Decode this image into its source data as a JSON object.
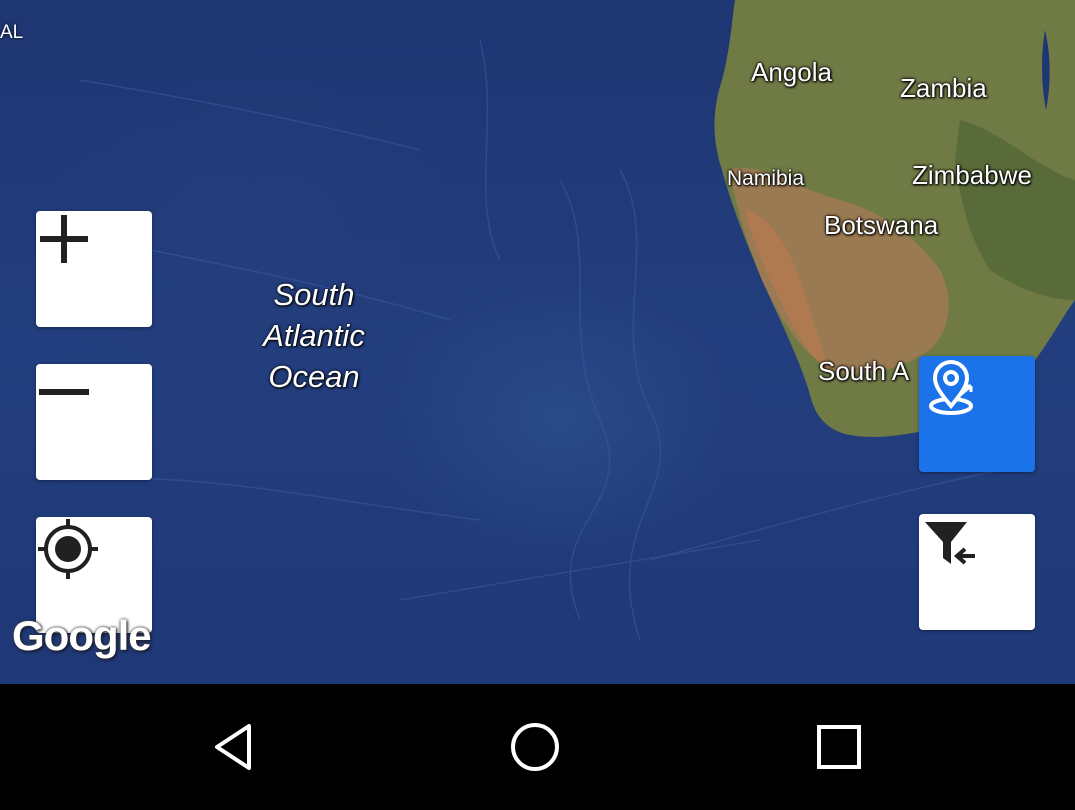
{
  "map": {
    "corner_label": "AL",
    "ocean_label": [
      "South",
      "Atlantic",
      "Ocean"
    ],
    "countries": {
      "angola": "Angola",
      "zambia": "Zambia",
      "namibia": "Namibia",
      "zimbabwe": "Zimbabwe",
      "botswana": "Botswana",
      "south_africa": "South A"
    },
    "attribution": "Google"
  },
  "controls": {
    "zoom_in_icon": "plus-icon",
    "zoom_out_icon": "minus-icon",
    "my_location_icon": "crosshair-icon",
    "place_marker_icon": "map-pin-icon",
    "filter_icon": "filter-arrow-icon",
    "accent_color": "#1a73e8"
  },
  "navbar": {
    "back_icon": "triangle-back-icon",
    "home_icon": "circle-home-icon",
    "recents_icon": "square-recents-icon"
  }
}
